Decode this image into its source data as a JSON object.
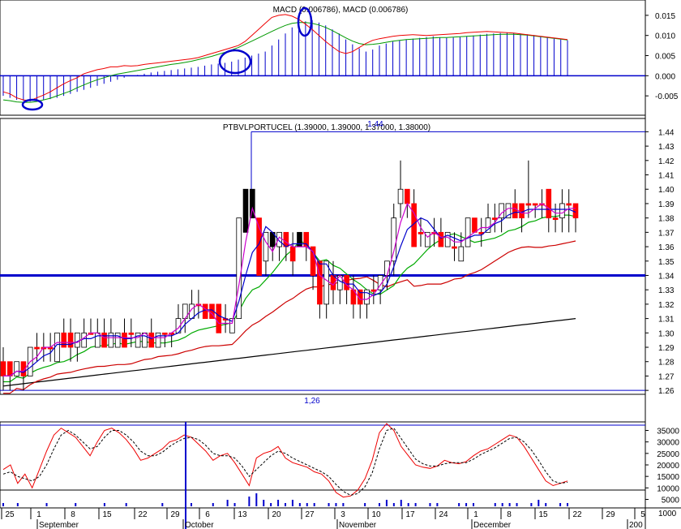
{
  "chart_data": {
    "type": "candlestick",
    "macd": {
      "title": "MACD (0.006786), MACD (0.006786)",
      "ylim": [
        -0.009,
        0.018
      ],
      "ticks": [
        "0.015",
        "0.010",
        "0.005",
        "0.000",
        "-0.005"
      ],
      "tick_values": [
        0.015,
        0.01,
        0.005,
        0.0,
        -0.005
      ],
      "histogram": [
        -0.005,
        -0.0055,
        -0.006,
        -0.0062,
        -0.0064,
        -0.0063,
        -0.006,
        -0.0058,
        -0.0055,
        -0.005,
        -0.0045,
        -0.004,
        -0.0035,
        -0.003,
        -0.0025,
        -0.002,
        -0.0015,
        -0.001,
        -0.0005,
        0.0,
        0.0002,
        0.0005,
        0.0008,
        0.001,
        0.0012,
        0.0014,
        0.0016,
        0.0018,
        0.002,
        0.0022,
        0.0025,
        0.0028,
        0.003,
        0.0032,
        0.0035,
        0.004,
        0.0045,
        0.005,
        0.0055,
        0.006,
        0.0075,
        0.009,
        0.0105,
        0.012,
        0.0128,
        0.0135,
        0.0138,
        0.0132,
        0.0125,
        0.0115,
        0.0105,
        0.009,
        0.0078,
        0.0068,
        0.006,
        0.0065,
        0.0075,
        0.008,
        0.0085,
        0.0088,
        0.009,
        0.0092,
        0.0094,
        0.0096,
        0.0098,
        0.0095,
        0.0094,
        0.0095,
        0.0096,
        0.0098,
        0.01,
        0.0102,
        0.0104,
        0.0105,
        0.0106,
        0.0107,
        0.0106,
        0.0105,
        0.0103,
        0.0101,
        0.0098,
        0.0095,
        0.0092,
        0.009,
        0.0088
      ],
      "signal_line": [
        -0.006,
        -0.0062,
        -0.0065,
        -0.0066,
        -0.0066,
        -0.0064,
        -0.006,
        -0.0056,
        -0.005,
        -0.0044,
        -0.0038,
        -0.003,
        -0.0023,
        -0.0016,
        -0.001,
        -0.0005,
        0.0,
        0.0004,
        0.0007,
        0.001,
        0.0013,
        0.0016,
        0.0019,
        0.0022,
        0.0025,
        0.0028,
        0.003,
        0.0033,
        0.0036,
        0.004,
        0.0044,
        0.0048,
        0.0053,
        0.0058,
        0.0064,
        0.007,
        0.0078,
        0.0086,
        0.0094,
        0.0102,
        0.011,
        0.0118,
        0.0125,
        0.013,
        0.0132,
        0.0132,
        0.013,
        0.0126,
        0.012,
        0.0112,
        0.0103,
        0.0094,
        0.0086,
        0.008,
        0.0077,
        0.0078,
        0.008,
        0.0083,
        0.0086,
        0.0088,
        0.009,
        0.0091,
        0.0092,
        0.0093,
        0.0094,
        0.0095,
        0.0095,
        0.0096,
        0.0097,
        0.0098,
        0.0099,
        0.01,
        0.0101,
        0.0102,
        0.0103,
        0.0103,
        0.0103,
        0.0102,
        0.0101,
        0.0099,
        0.0097,
        0.0095,
        0.0093,
        0.0091,
        0.0089
      ],
      "macd_line": [
        -0.004,
        -0.0045,
        -0.0055,
        -0.006,
        -0.0062,
        -0.0055,
        -0.0048,
        -0.004,
        -0.003,
        -0.002,
        -0.0012,
        -0.0005,
        0.0005,
        0.001,
        0.0015,
        0.0018,
        0.0022,
        0.0022,
        0.0025,
        0.0024,
        0.0025,
        0.0028,
        0.003,
        0.0032,
        0.0034,
        0.0036,
        0.0038,
        0.004,
        0.0042,
        0.0045,
        0.005,
        0.0055,
        0.006,
        0.0065,
        0.007,
        0.0075,
        0.0085,
        0.01,
        0.0115,
        0.013,
        0.0145,
        0.015,
        0.0152,
        0.0148,
        0.014,
        0.0128,
        0.0115,
        0.01,
        0.0085,
        0.0072,
        0.006,
        0.0055,
        0.006,
        0.007,
        0.008,
        0.0088,
        0.0092,
        0.0095,
        0.0098,
        0.01,
        0.0101,
        0.0102,
        0.0101,
        0.01,
        0.0101,
        0.0102,
        0.0103,
        0.0104,
        0.0105,
        0.0107,
        0.0108,
        0.0109,
        0.011,
        0.0109,
        0.0108,
        0.0107,
        0.0106,
        0.0104,
        0.0102,
        0.01,
        0.0098,
        0.0096,
        0.0094,
        0.0092,
        0.009
      ],
      "highlight_circles": 3
    },
    "price": {
      "title": "PTBVLPORTUCEL (1.39000, 1.39000, 1.37000, 1.38000)",
      "ylim": [
        1.255,
        1.447
      ],
      "ticks": [
        "1.44",
        "1.43",
        "1.42",
        "1.41",
        "1.40",
        "1.39",
        "1.38",
        "1.37",
        "1.36",
        "1.35",
        "1.34",
        "1.33",
        "1.32",
        "1.31",
        "1.30",
        "1.29",
        "1.28",
        "1.27",
        "1.26"
      ],
      "tick_values": [
        1.44,
        1.43,
        1.42,
        1.41,
        1.4,
        1.39,
        1.38,
        1.37,
        1.36,
        1.35,
        1.34,
        1.33,
        1.32,
        1.31,
        1.3,
        1.29,
        1.28,
        1.27,
        1.26
      ],
      "annotation_high": "1.44",
      "annotation_low": "1,26",
      "horizontal_line": 1.34,
      "high_level": 1.44,
      "low_level": 1.26,
      "candles": [
        [
          1.28,
          1.29,
          1.26,
          1.27
        ],
        [
          1.28,
          1.28,
          1.26,
          1.27
        ],
        [
          1.27,
          1.28,
          1.27,
          1.28
        ],
        [
          1.28,
          1.28,
          1.26,
          1.27
        ],
        [
          1.27,
          1.29,
          1.27,
          1.29
        ],
        [
          1.29,
          1.3,
          1.28,
          1.29
        ],
        [
          1.29,
          1.3,
          1.28,
          1.29
        ],
        [
          1.29,
          1.3,
          1.28,
          1.29
        ],
        [
          1.28,
          1.3,
          1.28,
          1.3
        ],
        [
          1.3,
          1.31,
          1.29,
          1.29
        ],
        [
          1.3,
          1.31,
          1.28,
          1.29
        ],
        [
          1.29,
          1.3,
          1.28,
          1.3
        ],
        [
          1.29,
          1.31,
          1.29,
          1.3
        ],
        [
          1.3,
          1.31,
          1.3,
          1.3
        ],
        [
          1.29,
          1.31,
          1.29,
          1.3
        ],
        [
          1.3,
          1.31,
          1.29,
          1.29
        ],
        [
          1.29,
          1.31,
          1.29,
          1.3
        ],
        [
          1.29,
          1.3,
          1.29,
          1.3
        ],
        [
          1.3,
          1.31,
          1.29,
          1.29
        ],
        [
          1.3,
          1.31,
          1.29,
          1.3
        ],
        [
          1.29,
          1.3,
          1.29,
          1.3
        ],
        [
          1.29,
          1.3,
          1.29,
          1.3
        ],
        [
          1.3,
          1.31,
          1.29,
          1.29
        ],
        [
          1.29,
          1.3,
          1.29,
          1.3
        ],
        [
          1.3,
          1.3,
          1.29,
          1.3
        ],
        [
          1.3,
          1.3,
          1.29,
          1.3
        ],
        [
          1.3,
          1.32,
          1.3,
          1.31
        ],
        [
          1.31,
          1.32,
          1.3,
          1.32
        ],
        [
          1.31,
          1.33,
          1.31,
          1.32
        ],
        [
          1.32,
          1.33,
          1.31,
          1.32
        ],
        [
          1.32,
          1.32,
          1.31,
          1.31
        ],
        [
          1.32,
          1.32,
          1.31,
          1.31
        ],
        [
          1.32,
          1.32,
          1.3,
          1.3
        ],
        [
          1.31,
          1.32,
          1.3,
          1.31
        ],
        [
          1.3,
          1.31,
          1.3,
          1.31
        ],
        [
          1.31,
          1.38,
          1.31,
          1.38
        ],
        [
          1.37,
          1.4,
          1.37,
          1.4
        ],
        [
          1.4,
          1.4,
          1.38,
          1.38
        ],
        [
          1.38,
          1.38,
          1.34,
          1.34
        ],
        [
          1.35,
          1.37,
          1.34,
          1.37
        ],
        [
          1.37,
          1.37,
          1.35,
          1.36
        ],
        [
          1.36,
          1.37,
          1.35,
          1.37
        ],
        [
          1.37,
          1.37,
          1.35,
          1.36
        ],
        [
          1.36,
          1.37,
          1.34,
          1.35
        ],
        [
          1.36,
          1.37,
          1.36,
          1.37
        ],
        [
          1.37,
          1.37,
          1.35,
          1.36
        ],
        [
          1.36,
          1.36,
          1.33,
          1.34
        ],
        [
          1.35,
          1.35,
          1.31,
          1.32
        ],
        [
          1.32,
          1.35,
          1.31,
          1.35
        ],
        [
          1.34,
          1.35,
          1.32,
          1.33
        ],
        [
          1.33,
          1.34,
          1.32,
          1.34
        ],
        [
          1.34,
          1.34,
          1.32,
          1.33
        ],
        [
          1.33,
          1.34,
          1.31,
          1.32
        ],
        [
          1.33,
          1.33,
          1.31,
          1.32
        ],
        [
          1.32,
          1.33,
          1.31,
          1.33
        ],
        [
          1.33,
          1.34,
          1.32,
          1.33
        ],
        [
          1.33,
          1.34,
          1.32,
          1.34
        ],
        [
          1.34,
          1.35,
          1.33,
          1.35
        ],
        [
          1.35,
          1.39,
          1.34,
          1.38
        ],
        [
          1.39,
          1.42,
          1.38,
          1.4
        ],
        [
          1.4,
          1.4,
          1.38,
          1.39
        ],
        [
          1.39,
          1.4,
          1.36,
          1.36
        ],
        [
          1.37,
          1.38,
          1.36,
          1.37
        ],
        [
          1.36,
          1.37,
          1.36,
          1.37
        ],
        [
          1.37,
          1.38,
          1.36,
          1.37
        ],
        [
          1.37,
          1.38,
          1.36,
          1.36
        ],
        [
          1.36,
          1.37,
          1.36,
          1.37
        ],
        [
          1.36,
          1.37,
          1.35,
          1.36
        ],
        [
          1.35,
          1.37,
          1.35,
          1.36
        ],
        [
          1.36,
          1.38,
          1.36,
          1.38
        ],
        [
          1.38,
          1.38,
          1.37,
          1.37
        ],
        [
          1.37,
          1.38,
          1.36,
          1.37
        ],
        [
          1.37,
          1.39,
          1.37,
          1.38
        ],
        [
          1.38,
          1.39,
          1.37,
          1.38
        ],
        [
          1.38,
          1.39,
          1.37,
          1.39
        ],
        [
          1.38,
          1.39,
          1.38,
          1.39
        ],
        [
          1.39,
          1.4,
          1.38,
          1.38
        ],
        [
          1.39,
          1.39,
          1.37,
          1.38
        ],
        [
          1.39,
          1.42,
          1.38,
          1.39
        ],
        [
          1.39,
          1.39,
          1.38,
          1.39
        ],
        [
          1.39,
          1.4,
          1.38,
          1.39
        ],
        [
          1.4,
          1.4,
          1.37,
          1.38
        ],
        [
          1.38,
          1.39,
          1.37,
          1.38
        ],
        [
          1.38,
          1.4,
          1.37,
          1.39
        ],
        [
          1.39,
          1.4,
          1.37,
          1.39
        ],
        [
          1.39,
          1.39,
          1.37,
          1.38
        ]
      ],
      "colors": {
        "up": "#ffffff",
        "down": "#ff0000",
        "doji": "#000000",
        "ma_short": "#cc00cc",
        "ma_medium": "#0000cc",
        "ma_green": "#00aa00",
        "ma_red": "#cc0000",
        "ma_long": "#000000",
        "guide": "#0000cc"
      }
    },
    "stochastic": {
      "ticks": [
        "35000",
        "30000",
        "25000",
        "20000",
        "15000",
        "10000",
        "5000"
      ],
      "tick_values": [
        35000,
        30000,
        25000,
        20000,
        15000,
        10000,
        5000
      ],
      "ylim": [
        2000,
        38000
      ],
      "k_line": [
        18000,
        20000,
        12000,
        16000,
        10000,
        18000,
        26000,
        33000,
        36000,
        34000,
        32000,
        28000,
        24000,
        30000,
        35000,
        36000,
        34000,
        31000,
        27000,
        22000,
        23000,
        25000,
        27000,
        30000,
        31000,
        33000,
        32000,
        29000,
        26000,
        22000,
        24000,
        25000,
        21000,
        16000,
        11000,
        23000,
        25000,
        26000,
        28000,
        23000,
        21000,
        20000,
        19000,
        17000,
        16000,
        13000,
        8000,
        6000,
        6500,
        9000,
        14000,
        22000,
        34000,
        38000,
        35000,
        28000,
        24000,
        20000,
        19000,
        18500,
        19500,
        22000,
        21000,
        20500,
        21500,
        24000,
        26000,
        27000,
        29000,
        31000,
        33000,
        32000,
        28000,
        23000,
        18000,
        13000,
        11000,
        12000,
        13000
      ],
      "d_line": [
        16000,
        17000,
        15000,
        14000,
        13000,
        15000,
        20000,
        27000,
        33000,
        35000,
        33000,
        30000,
        27000,
        28000,
        32000,
        35000,
        35000,
        33000,
        30000,
        26000,
        24000,
        24000,
        25500,
        28000,
        30000,
        31500,
        32000,
        31000,
        28500,
        25000,
        24000,
        24000,
        23000,
        19500,
        15000,
        18000,
        21000,
        24000,
        26000,
        25000,
        23000,
        21500,
        20000,
        18500,
        17000,
        15000,
        11500,
        8500,
        6800,
        7500,
        10500,
        16500,
        27000,
        35000,
        36000,
        31500,
        27000,
        22500,
        20500,
        19500,
        19500,
        20500,
        21000,
        21000,
        21000,
        22500,
        24500,
        26000,
        27500,
        29500,
        31500,
        32000,
        30000,
        26500,
        22000,
        17000,
        13000,
        12000,
        12500
      ],
      "volume": [
        1,
        0,
        1,
        0,
        0,
        0,
        1,
        0,
        0,
        0,
        1,
        0,
        0,
        0,
        1,
        0,
        0,
        1,
        0,
        0,
        0,
        0,
        1,
        0,
        0,
        0,
        1,
        0,
        0,
        1,
        0,
        2,
        1,
        0,
        3,
        4,
        2,
        1,
        2,
        1,
        2,
        1,
        1,
        1,
        0,
        1,
        1,
        1,
        0,
        0,
        1,
        0,
        1,
        2,
        1,
        2,
        1,
        1,
        0,
        1,
        1,
        0,
        0,
        1,
        1,
        1,
        0,
        0,
        1,
        1,
        1,
        1,
        0,
        1,
        2,
        1,
        0,
        1,
        1
      ],
      "cursor_label": "1000"
    },
    "x_axis": {
      "day_labels": [
        "25",
        "1",
        "8",
        "15",
        "22",
        "29",
        "6",
        "13",
        "20",
        "27",
        "3",
        "10",
        "17",
        "24",
        "1",
        "8",
        "15",
        "22",
        "29",
        "5"
      ],
      "month_labels": [
        "September",
        "October",
        "November",
        "December",
        "200"
      ]
    }
  }
}
